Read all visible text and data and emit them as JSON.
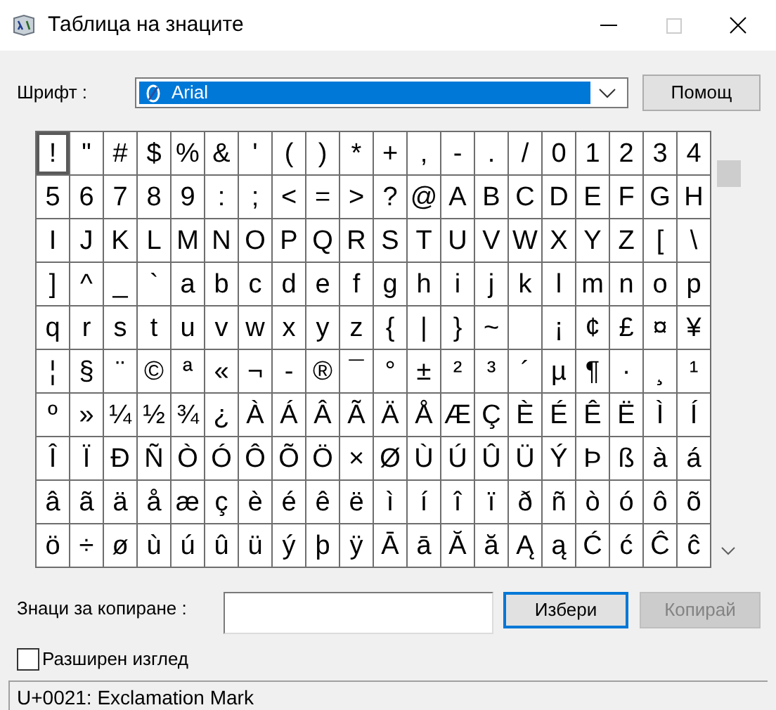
{
  "window": {
    "title": "Таблица на знаците",
    "maximize_disabled": true
  },
  "font": {
    "label": "Шрифт :",
    "value": "Arial"
  },
  "help_button": "Помощ",
  "grid": {
    "rows": [
      {
        "cells": [
          {
            "char": "!",
            "selected": true
          },
          {
            "char": "\"",
            "selected": false
          },
          {
            "char": "#",
            "selected": false
          },
          {
            "char": "$",
            "selected": false
          },
          {
            "char": "%",
            "selected": false
          },
          {
            "char": "&",
            "selected": false
          },
          {
            "char": "'",
            "selected": false
          },
          {
            "char": "(",
            "selected": false
          },
          {
            "char": ")",
            "selected": false
          },
          {
            "char": "*",
            "selected": false
          },
          {
            "char": "+",
            "selected": false
          },
          {
            "char": ",",
            "selected": false
          },
          {
            "char": "-",
            "selected": false
          },
          {
            "char": ".",
            "selected": false
          },
          {
            "char": "/",
            "selected": false
          },
          {
            "char": "0",
            "selected": false
          },
          {
            "char": "1",
            "selected": false
          },
          {
            "char": "2",
            "selected": false
          },
          {
            "char": "3",
            "selected": false
          },
          {
            "char": "4",
            "selected": false
          }
        ]
      },
      {
        "cells": [
          {
            "char": "5",
            "selected": false
          },
          {
            "char": "6",
            "selected": false
          },
          {
            "char": "7",
            "selected": false
          },
          {
            "char": "8",
            "selected": false
          },
          {
            "char": "9",
            "selected": false
          },
          {
            "char": ":",
            "selected": false
          },
          {
            "char": ";",
            "selected": false
          },
          {
            "char": "<",
            "selected": false
          },
          {
            "char": "=",
            "selected": false
          },
          {
            "char": ">",
            "selected": false
          },
          {
            "char": "?",
            "selected": false
          },
          {
            "char": "@",
            "selected": false
          },
          {
            "char": "A",
            "selected": false
          },
          {
            "char": "B",
            "selected": false
          },
          {
            "char": "C",
            "selected": false
          },
          {
            "char": "D",
            "selected": false
          },
          {
            "char": "E",
            "selected": false
          },
          {
            "char": "F",
            "selected": false
          },
          {
            "char": "G",
            "selected": false
          },
          {
            "char": "H",
            "selected": false
          }
        ]
      },
      {
        "cells": [
          {
            "char": "I",
            "selected": false
          },
          {
            "char": "J",
            "selected": false
          },
          {
            "char": "K",
            "selected": false
          },
          {
            "char": "L",
            "selected": false
          },
          {
            "char": "M",
            "selected": false
          },
          {
            "char": "N",
            "selected": false
          },
          {
            "char": "O",
            "selected": false
          },
          {
            "char": "P",
            "selected": false
          },
          {
            "char": "Q",
            "selected": false
          },
          {
            "char": "R",
            "selected": false
          },
          {
            "char": "S",
            "selected": false
          },
          {
            "char": "T",
            "selected": false
          },
          {
            "char": "U",
            "selected": false
          },
          {
            "char": "V",
            "selected": false
          },
          {
            "char": "W",
            "selected": false
          },
          {
            "char": "X",
            "selected": false
          },
          {
            "char": "Y",
            "selected": false
          },
          {
            "char": "Z",
            "selected": false
          },
          {
            "char": "[",
            "selected": false
          },
          {
            "char": "\\",
            "selected": false
          }
        ]
      },
      {
        "cells": [
          {
            "char": "]",
            "selected": false
          },
          {
            "char": "^",
            "selected": false
          },
          {
            "char": "_",
            "selected": false
          },
          {
            "char": "`",
            "selected": false
          },
          {
            "char": "a",
            "selected": false
          },
          {
            "char": "b",
            "selected": false
          },
          {
            "char": "c",
            "selected": false
          },
          {
            "char": "d",
            "selected": false
          },
          {
            "char": "e",
            "selected": false
          },
          {
            "char": "f",
            "selected": false
          },
          {
            "char": "g",
            "selected": false
          },
          {
            "char": "h",
            "selected": false
          },
          {
            "char": "i",
            "selected": false
          },
          {
            "char": "j",
            "selected": false
          },
          {
            "char": "k",
            "selected": false
          },
          {
            "char": "l",
            "selected": false
          },
          {
            "char": "m",
            "selected": false
          },
          {
            "char": "n",
            "selected": false
          },
          {
            "char": "o",
            "selected": false
          },
          {
            "char": "p",
            "selected": false
          }
        ]
      },
      {
        "cells": [
          {
            "char": "q",
            "selected": false
          },
          {
            "char": "r",
            "selected": false
          },
          {
            "char": "s",
            "selected": false
          },
          {
            "char": "t",
            "selected": false
          },
          {
            "char": "u",
            "selected": false
          },
          {
            "char": "v",
            "selected": false
          },
          {
            "char": "w",
            "selected": false
          },
          {
            "char": "x",
            "selected": false
          },
          {
            "char": "y",
            "selected": false
          },
          {
            "char": "z",
            "selected": false
          },
          {
            "char": "{",
            "selected": false
          },
          {
            "char": "|",
            "selected": false
          },
          {
            "char": "}",
            "selected": false
          },
          {
            "char": "~",
            "selected": false
          },
          {
            "selected": false
          },
          {
            "char": "¡",
            "selected": false
          },
          {
            "char": "¢",
            "selected": false
          },
          {
            "char": "£",
            "selected": false
          },
          {
            "char": "¤",
            "selected": false
          },
          {
            "char": "¥",
            "selected": false
          }
        ]
      },
      {
        "cells": [
          {
            "char": "¦",
            "selected": false
          },
          {
            "char": "§",
            "selected": false
          },
          {
            "char": "¨",
            "selected": false
          },
          {
            "char": "©",
            "selected": false
          },
          {
            "char": "ª",
            "selected": false
          },
          {
            "char": "«",
            "selected": false
          },
          {
            "char": "¬",
            "selected": false
          },
          {
            "char": "-",
            "selected": false
          },
          {
            "char": "®",
            "selected": false
          },
          {
            "char": "¯",
            "selected": false
          },
          {
            "char": "°",
            "selected": false
          },
          {
            "char": "±",
            "selected": false
          },
          {
            "char": "²",
            "selected": false
          },
          {
            "char": "³",
            "selected": false
          },
          {
            "char": "´",
            "selected": false
          },
          {
            "char": "µ",
            "selected": false
          },
          {
            "char": "¶",
            "selected": false
          },
          {
            "char": "·",
            "selected": false
          },
          {
            "char": "¸",
            "selected": false
          },
          {
            "char": "¹",
            "selected": false
          }
        ]
      },
      {
        "cells": [
          {
            "char": "º",
            "selected": false
          },
          {
            "char": "»",
            "selected": false
          },
          {
            "char": "¼",
            "selected": false
          },
          {
            "char": "½",
            "selected": false
          },
          {
            "char": "¾",
            "selected": false
          },
          {
            "char": "¿",
            "selected": false
          },
          {
            "char": "À",
            "selected": false
          },
          {
            "char": "Á",
            "selected": false
          },
          {
            "char": "Â",
            "selected": false
          },
          {
            "char": "Ã",
            "selected": false
          },
          {
            "char": "Ä",
            "selected": false
          },
          {
            "char": "Å",
            "selected": false
          },
          {
            "char": "Æ",
            "selected": false
          },
          {
            "char": "Ç",
            "selected": false
          },
          {
            "char": "È",
            "selected": false
          },
          {
            "char": "É",
            "selected": false
          },
          {
            "char": "Ê",
            "selected": false
          },
          {
            "char": "Ë",
            "selected": false
          },
          {
            "char": "Ì",
            "selected": false
          },
          {
            "char": "Í",
            "selected": false
          }
        ]
      },
      {
        "cells": [
          {
            "char": "Î",
            "selected": false
          },
          {
            "char": "Ï",
            "selected": false
          },
          {
            "char": "Ð",
            "selected": false
          },
          {
            "char": "Ñ",
            "selected": false
          },
          {
            "char": "Ò",
            "selected": false
          },
          {
            "char": "Ó",
            "selected": false
          },
          {
            "char": "Ô",
            "selected": false
          },
          {
            "char": "Õ",
            "selected": false
          },
          {
            "char": "Ö",
            "selected": false
          },
          {
            "char": "×",
            "selected": false
          },
          {
            "char": "Ø",
            "selected": false
          },
          {
            "char": "Ù",
            "selected": false
          },
          {
            "char": "Ú",
            "selected": false
          },
          {
            "char": "Û",
            "selected": false
          },
          {
            "char": "Ü",
            "selected": false
          },
          {
            "char": "Ý",
            "selected": false
          },
          {
            "char": "Þ",
            "selected": false
          },
          {
            "char": "ß",
            "selected": false
          },
          {
            "char": "à",
            "selected": false
          },
          {
            "char": "á",
            "selected": false
          }
        ]
      },
      {
        "cells": [
          {
            "char": "â",
            "selected": false
          },
          {
            "char": "ã",
            "selected": false
          },
          {
            "char": "ä",
            "selected": false
          },
          {
            "char": "å",
            "selected": false
          },
          {
            "char": "æ",
            "selected": false
          },
          {
            "char": "ç",
            "selected": false
          },
          {
            "char": "è",
            "selected": false
          },
          {
            "char": "é",
            "selected": false
          },
          {
            "char": "ê",
            "selected": false
          },
          {
            "char": "ë",
            "selected": false
          },
          {
            "char": "ì",
            "selected": false
          },
          {
            "char": "í",
            "selected": false
          },
          {
            "char": "î",
            "selected": false
          },
          {
            "char": "ï",
            "selected": false
          },
          {
            "char": "ð",
            "selected": false
          },
          {
            "char": "ñ",
            "selected": false
          },
          {
            "char": "ò",
            "selected": false
          },
          {
            "char": "ó",
            "selected": false
          },
          {
            "char": "ô",
            "selected": false
          },
          {
            "char": "õ",
            "selected": false
          }
        ]
      },
      {
        "cells": [
          {
            "char": "ö",
            "selected": false
          },
          {
            "char": "÷",
            "selected": false
          },
          {
            "char": "ø",
            "selected": false
          },
          {
            "char": "ù",
            "selected": false
          },
          {
            "char": "ú",
            "selected": false
          },
          {
            "char": "û",
            "selected": false
          },
          {
            "char": "ü",
            "selected": false
          },
          {
            "char": "ý",
            "selected": false
          },
          {
            "char": "þ",
            "selected": false
          },
          {
            "char": "ÿ",
            "selected": false
          },
          {
            "char": "Ā",
            "selected": false
          },
          {
            "char": "ā",
            "selected": false
          },
          {
            "char": "Ă",
            "selected": false
          },
          {
            "char": "ă",
            "selected": false
          },
          {
            "char": "Ą",
            "selected": false
          },
          {
            "char": "ą",
            "selected": false
          },
          {
            "char": "Ć",
            "selected": false
          },
          {
            "char": "ć",
            "selected": false
          },
          {
            "char": "Ĉ",
            "selected": false
          },
          {
            "char": "ĉ",
            "selected": false
          }
        ]
      }
    ]
  },
  "copy": {
    "label": "Знаци за копиране :",
    "select_button": "Избери",
    "copy_button": "Копирай",
    "copy_disabled": true
  },
  "advanced_view": {
    "label": "Разширен изглед",
    "checked": false
  },
  "status_bar": "U+0021: Exclamation Mark"
}
